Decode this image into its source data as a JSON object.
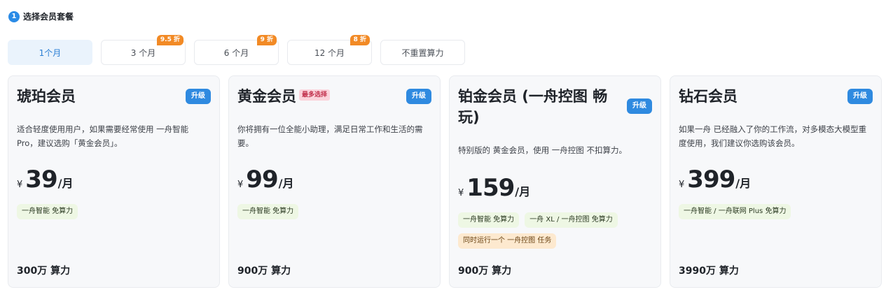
{
  "step": {
    "number": "1",
    "title": "选择会员套餐"
  },
  "tabs": [
    {
      "label": "1个月",
      "badge": ""
    },
    {
      "label": "3 个月",
      "badge": "9.5 折"
    },
    {
      "label": "6 个月",
      "badge": "9 折"
    },
    {
      "label": "12 个月",
      "badge": "8 折"
    },
    {
      "label": "不重置算力",
      "badge": ""
    }
  ],
  "active_tab_index": 0,
  "currency": "¥",
  "per_month": "/月",
  "upgrade_label": "升级",
  "cards": [
    {
      "title": "琥珀会员",
      "badge": "",
      "desc": "适合轻度使用用户，如果需要经常使用 一舟智能 Pro，建议选购「黄金会员」。",
      "price": "39",
      "tags": [
        {
          "text": "一舟智能 免算力",
          "tone": "green"
        }
      ],
      "compute": "300万 算力"
    },
    {
      "title": "黄金会员",
      "badge": "最多选择",
      "desc": "你将拥有一位全能小助理，满足日常工作和生活的需要。",
      "price": "99",
      "tags": [
        {
          "text": "一舟智能 免算力",
          "tone": "green"
        }
      ],
      "compute": "900万 算力"
    },
    {
      "title": "铂金会员 (一舟控图 畅玩)",
      "badge": "",
      "desc": "特别版的 黄金会员，使用 一舟控图 不扣算力。",
      "price": "159",
      "tags": [
        {
          "text": "一舟智能 免算力",
          "tone": "green"
        },
        {
          "text": "一舟 XL / 一舟控图 免算力",
          "tone": "green"
        },
        {
          "text": "同时运行一个 一舟控图 任务",
          "tone": "orange"
        }
      ],
      "compute": "900万 算力"
    },
    {
      "title": "钻石会员",
      "badge": "",
      "desc": "如果一舟 已经融入了你的工作流，对多模态大模型重度使用，我们建议你选购该会员。",
      "price": "399",
      "tags": [
        {
          "text": "一舟智能 / 一舟联网 Plus 免算力",
          "tone": "green"
        }
      ],
      "compute": "3990万 算力"
    }
  ]
}
